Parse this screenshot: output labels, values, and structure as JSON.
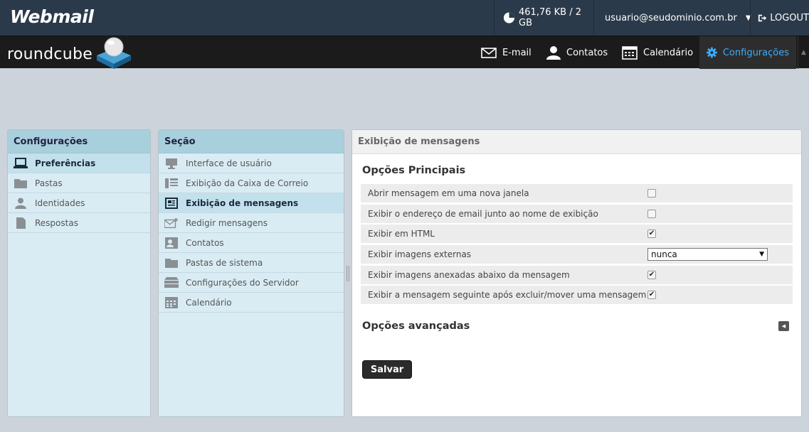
{
  "topbar": {
    "brand": "Webmail",
    "quota": "461,76 KB / 2 GB",
    "user": "usuario@seudominio.com.br",
    "logout": "LOGOUT"
  },
  "rcbar": {
    "logo_text": "roundcube",
    "nav": {
      "mail": "E-mail",
      "contacts": "Contatos",
      "calendar": "Calendário",
      "settings": "Configurações"
    }
  },
  "settings_panel": {
    "title": "Configurações",
    "items": [
      {
        "label": "Preferências",
        "icon": "laptop-icon",
        "selected": true
      },
      {
        "label": "Pastas",
        "icon": "folder-icon",
        "selected": false
      },
      {
        "label": "Identidades",
        "icon": "person-icon",
        "selected": false
      },
      {
        "label": "Respostas",
        "icon": "document-icon",
        "selected": false
      }
    ]
  },
  "section_panel": {
    "title": "Seção",
    "items": [
      {
        "label": "Interface de usuário",
        "icon": "monitor-icon",
        "selected": false
      },
      {
        "label": "Exibição da Caixa de Correio",
        "icon": "list-layout-icon",
        "selected": false
      },
      {
        "label": "Exibição de mensagens",
        "icon": "message-view-icon",
        "selected": true
      },
      {
        "label": "Redigir mensagens",
        "icon": "compose-icon",
        "selected": false
      },
      {
        "label": "Contatos",
        "icon": "contact-card-icon",
        "selected": false
      },
      {
        "label": "Pastas de sistema",
        "icon": "folder-icon",
        "selected": false
      },
      {
        "label": "Configurações do Servidor",
        "icon": "server-icon",
        "selected": false
      },
      {
        "label": "Calendário",
        "icon": "calendar-icon",
        "selected": false
      }
    ]
  },
  "main": {
    "title": "Exibição de mensagens",
    "main_options_title": "Opções Principais",
    "options": [
      {
        "label": "Abrir mensagem em uma nova janela",
        "type": "checkbox",
        "checked": false
      },
      {
        "label": "Exibir o endereço de email junto ao nome de exibição",
        "type": "checkbox",
        "checked": false
      },
      {
        "label": "Exibir em HTML",
        "type": "checkbox",
        "checked": true
      },
      {
        "label": "Exibir imagens externas",
        "type": "select",
        "value": "nunca"
      },
      {
        "label": "Exibir imagens anexadas abaixo da mensagem",
        "type": "checkbox",
        "checked": true
      },
      {
        "label": "Exibir a mensagem seguinte após excluir/mover uma mensagem",
        "type": "checkbox",
        "checked": true
      }
    ],
    "advanced_title": "Opções avançadas",
    "save_label": "Salvar"
  },
  "colors": {
    "topbar_bg": "#2b3a4a",
    "rcbar_bg": "#1b1b1b",
    "accent": "#3cadfd",
    "panel_bg": "#d9ecf4",
    "panel_head": "#a8cfdc"
  }
}
